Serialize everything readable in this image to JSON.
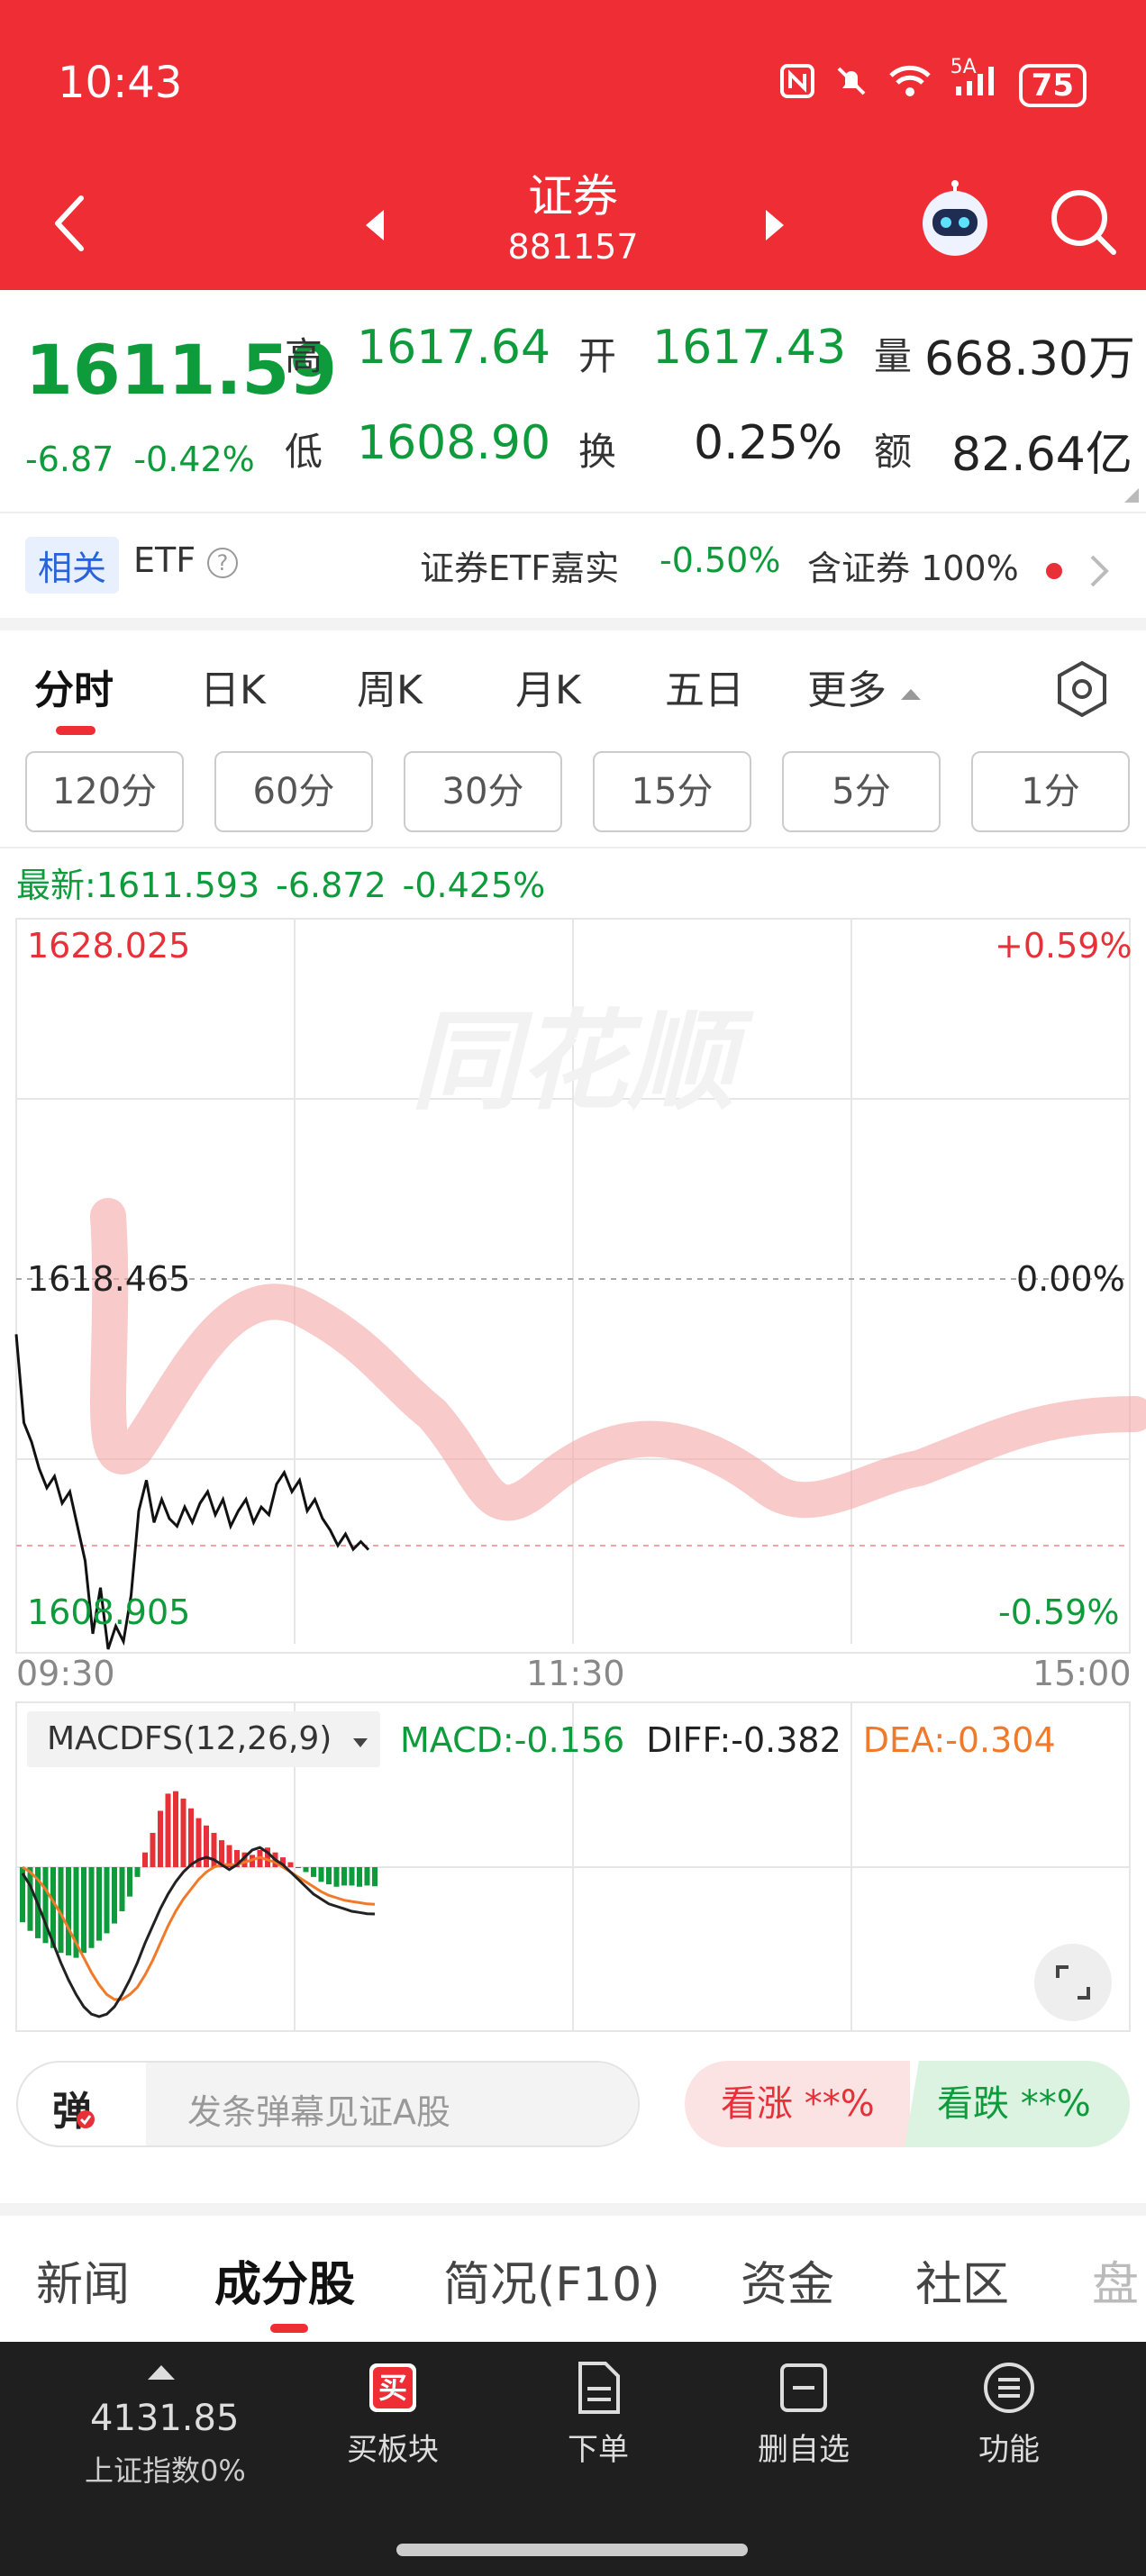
{
  "status_bar": {
    "time": "10:43",
    "network": "5A",
    "battery": "75"
  },
  "header": {
    "title": "证券",
    "code": "881157"
  },
  "quote": {
    "price": "1611.59",
    "change": "-6.87",
    "change_pct": "-0.42%",
    "high_label": "高",
    "high": "1617.64",
    "open_label": "开",
    "open": "1617.43",
    "volume_label": "量",
    "volume": "668.30万",
    "low_label": "低",
    "low": "1608.90",
    "turnover_label": "换",
    "turnover": "0.25%",
    "amount_label": "额",
    "amount": "82.64亿"
  },
  "etf": {
    "tag": "相关",
    "label": "ETF",
    "help": "?",
    "name": "证券ETF嘉实",
    "change": "-0.50%",
    "holding": "含证券 100%"
  },
  "chart_tabs": [
    "分时",
    "日K",
    "周K",
    "月K",
    "五日",
    "更多"
  ],
  "periods": [
    "120分",
    "60分",
    "30分",
    "15分",
    "5分",
    "1分"
  ],
  "latest": {
    "label": "最新:1611.593",
    "change": "-6.872",
    "pct": "-0.425%"
  },
  "axis": {
    "top_price": "1628.025",
    "top_pct": "+0.59%",
    "mid_price": "1618.465",
    "mid_pct": "0.00%",
    "bot_price": "1608.905",
    "bot_pct": "-0.59%",
    "t_start": "09:30",
    "t_mid": "11:30",
    "t_end": "15:00"
  },
  "watermark": "同花顺",
  "macd": {
    "name": "MACDFS(12,26,9)",
    "macd": "MACD:-0.156",
    "diff": "DIFF:-0.382",
    "dea": "DEA:-0.304"
  },
  "chart_data": {
    "type": "line",
    "title": "",
    "xlabel": "",
    "ylabel": "",
    "x_range": [
      "09:30",
      "15:00"
    ],
    "ylim": [
      1608.905,
      1628.025
    ],
    "reference": 1618.465,
    "series": [
      {
        "values": [
          1617.2,
          1614.9,
          1614.4,
          1613.7,
          1613.2,
          1613.5,
          1612.8,
          1613.1,
          1612.2,
          1611.3,
          1609.4,
          1610.6,
          1609.0,
          1609.6,
          1609.2,
          1610.4,
          1612.6,
          1613.4,
          1612.3,
          1612.9,
          1612.4,
          1612.2,
          1612.7,
          1612.3,
          1612.8,
          1613.1,
          1612.5,
          1612.9,
          1612.2,
          1612.6,
          1612.9,
          1612.3,
          1612.7,
          1612.5,
          1613.3,
          1613.6,
          1613.1,
          1613.4,
          1612.6,
          1612.9,
          1612.4,
          1612.1,
          1611.7,
          1612.0,
          1611.6,
          1611.8,
          1611.59
        ]
      }
    ],
    "colors": {
      "price": "#111111",
      "up": "#e83038",
      "down": "#0e9b3b",
      "dea": "#f07a2a",
      "diff": "#222222"
    },
    "macd_hist": [
      -0.45,
      -0.52,
      -0.58,
      -0.62,
      -0.66,
      -0.7,
      -0.72,
      -0.74,
      -0.7,
      -0.66,
      -0.6,
      -0.54,
      -0.46,
      -0.36,
      -0.24,
      -0.08,
      0.12,
      0.28,
      0.46,
      0.6,
      0.62,
      0.56,
      0.48,
      0.4,
      0.34,
      0.28,
      0.22,
      0.18,
      0.14,
      0.12,
      0.1,
      0.14,
      0.16,
      0.12,
      0.08,
      0.04,
      0.0,
      -0.04,
      -0.08,
      -0.12,
      -0.14,
      -0.16,
      -0.15,
      -0.15,
      -0.16,
      -0.15,
      -0.156
    ],
    "diff_line": [
      -0.05,
      -0.15,
      -0.3,
      -0.46,
      -0.62,
      -0.78,
      -0.92,
      -1.04,
      -1.14,
      -1.2,
      -1.22,
      -1.2,
      -1.14,
      -1.04,
      -0.92,
      -0.78,
      -0.62,
      -0.48,
      -0.34,
      -0.22,
      -0.12,
      -0.04,
      0.02,
      0.06,
      0.08,
      0.06,
      0.02,
      -0.02,
      0.02,
      0.08,
      0.14,
      0.16,
      0.12,
      0.06,
      0.02,
      -0.04,
      -0.1,
      -0.16,
      -0.22,
      -0.26,
      -0.3,
      -0.32,
      -0.34,
      -0.36,
      -0.37,
      -0.38,
      -0.382
    ],
    "dea_line": [
      0.0,
      -0.04,
      -0.1,
      -0.18,
      -0.28,
      -0.38,
      -0.5,
      -0.62,
      -0.74,
      -0.86,
      -0.96,
      -1.04,
      -1.08,
      -1.08,
      -1.04,
      -0.98,
      -0.88,
      -0.76,
      -0.62,
      -0.48,
      -0.36,
      -0.26,
      -0.18,
      -0.1,
      -0.04,
      0.0,
      0.02,
      0.02,
      0.02,
      0.04,
      0.06,
      0.08,
      0.06,
      0.04,
      0.0,
      -0.04,
      -0.08,
      -0.12,
      -0.16,
      -0.2,
      -0.23,
      -0.25,
      -0.27,
      -0.28,
      -0.29,
      -0.3,
      -0.304
    ]
  },
  "danmu": {
    "icon": "弹",
    "placeholder": "发条弹幕见证A股"
  },
  "sentiment": {
    "rise": "看涨  **%",
    "fall": "看跌  **%"
  },
  "bottom_tabs": [
    "新闻",
    "成分股",
    "简况(F10)",
    "资金",
    "社区",
    "盘"
  ],
  "toolbar": {
    "index_value": "4131.85",
    "index_label": "上证指数0%",
    "items": [
      "买板块",
      "下单",
      "删自选",
      "功能"
    ]
  }
}
